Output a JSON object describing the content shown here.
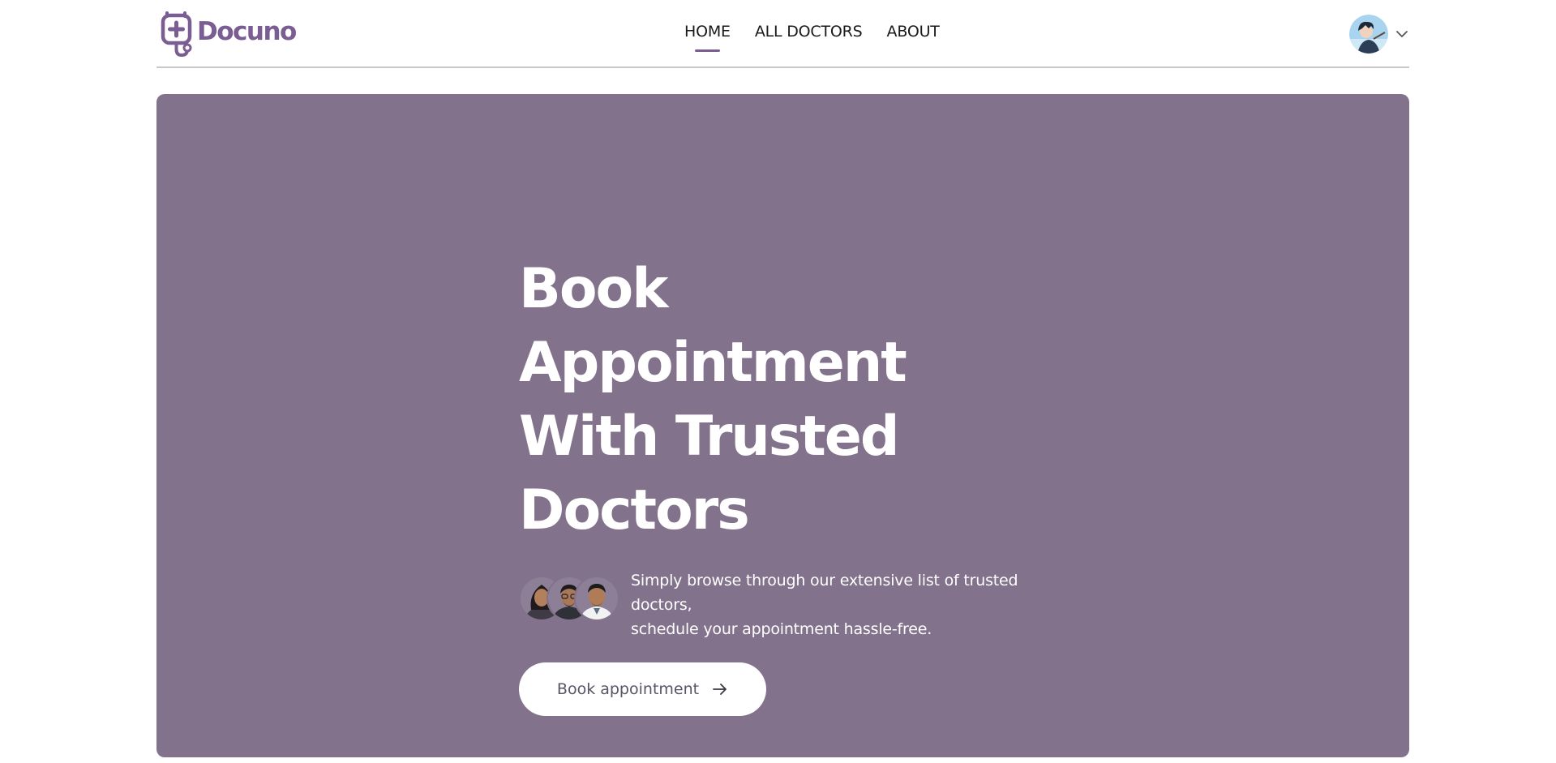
{
  "brand": {
    "name": "Docuno",
    "color": "#7a5d92"
  },
  "nav": {
    "items": [
      {
        "label": "HOME",
        "active": true
      },
      {
        "label": "ALL DOCTORS",
        "active": false
      },
      {
        "label": "ABOUT",
        "active": false
      }
    ]
  },
  "profile": {
    "avatar_icon": "user-avatar",
    "menu_icon": "chevron-down-icon"
  },
  "hero": {
    "background": "#82728c",
    "title_lines": [
      "Book Appointment",
      "With Trusted",
      "Doctors"
    ],
    "description_lines": [
      "Simply browse through our extensive list of trusted",
      "doctors,",
      "schedule your appointment hassle-free."
    ],
    "cta_label": "Book appointment",
    "cta_icon": "arrow-right-icon"
  }
}
